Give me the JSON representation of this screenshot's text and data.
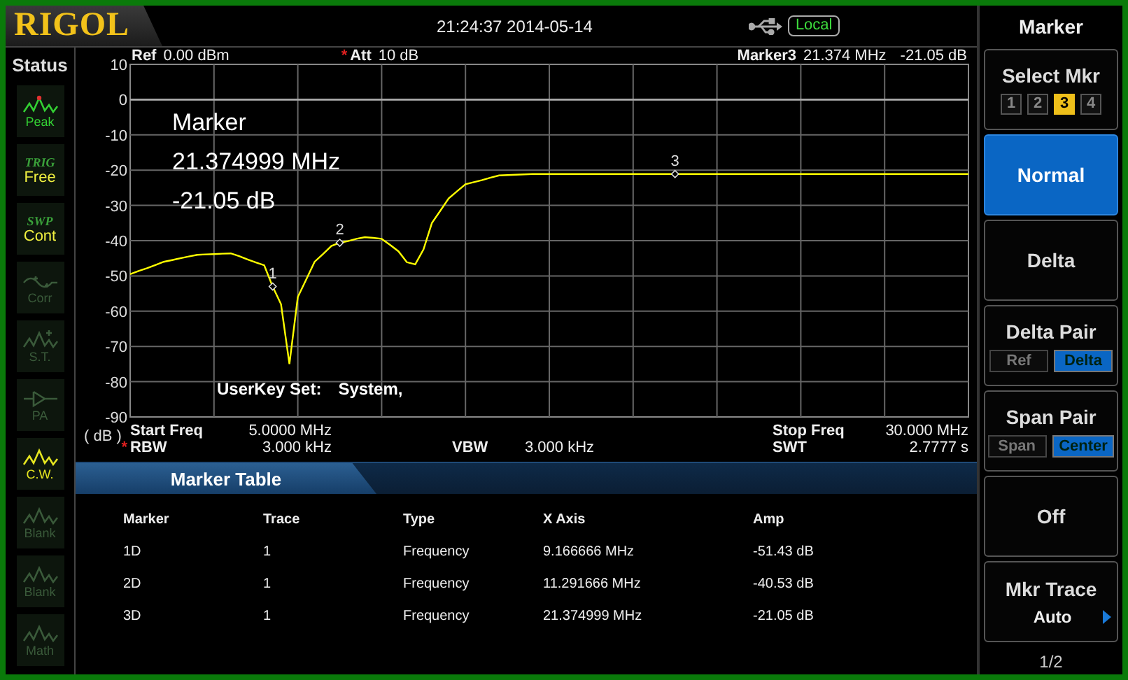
{
  "header": {
    "logo": "RIGOL",
    "datetime": "21:24:37 2014-05-14",
    "remote_status": "Local"
  },
  "status": {
    "title": "Status",
    "items": [
      {
        "kind": "peak",
        "label": "Peak",
        "color": "#33d033"
      },
      {
        "kind": "text",
        "heading": "TRIG",
        "value": "Free"
      },
      {
        "kind": "text",
        "heading": "SWP",
        "value": "Cont"
      },
      {
        "kind": "corr",
        "label": "Corr",
        "color": "#3a5a3a"
      },
      {
        "kind": "st",
        "label": "S.T.",
        "color": "#3a5a3a"
      },
      {
        "kind": "pa",
        "label": "PA",
        "color": "#3a5a3a"
      },
      {
        "kind": "wave",
        "label": "C.W.",
        "color": "#e6e620"
      },
      {
        "kind": "wave",
        "label": "Blank",
        "color": "#3a5a3a"
      },
      {
        "kind": "wave",
        "label": "Blank",
        "color": "#3a5a3a"
      },
      {
        "kind": "wave",
        "label": "Math",
        "color": "#3a5a3a"
      }
    ]
  },
  "plot": {
    "ref_label": "Ref",
    "ref_value": "0.00 dBm",
    "att_flag": "*",
    "att_label": "Att",
    "att_value": "10 dB",
    "marker_label": "Marker3",
    "marker_freq": "21.374 MHz",
    "marker_amp": "-21.05 dB",
    "readout": [
      "Marker",
      "21.374999 MHz",
      "-21.05 dB"
    ],
    "userkey_label": "UserKey Set:",
    "userkey_value": "System,",
    "trace_markers": [
      "1",
      "2",
      "3"
    ],
    "chart_data": {
      "type": "line",
      "grid": true,
      "ylabel": "( dB )",
      "ylim": [
        -90,
        10
      ],
      "yticks": [
        10,
        0,
        -10,
        -20,
        -30,
        -40,
        -50,
        -60,
        -70,
        -80,
        -90
      ],
      "categories": [
        null,
        null,
        null,
        null,
        null,
        null,
        null,
        null,
        null,
        null,
        null,
        null,
        null,
        null,
        null,
        null,
        null,
        null,
        null,
        null,
        null,
        null,
        null,
        null,
        null,
        null,
        null,
        null,
        null,
        null,
        null,
        null,
        null,
        null,
        null,
        null,
        null,
        null,
        null,
        null,
        null,
        null,
        null,
        null,
        null,
        null,
        null,
        null,
        null,
        null,
        null,
        null,
        null,
        null,
        null,
        null,
        null,
        null,
        null,
        null,
        null,
        null,
        null,
        null,
        null,
        null,
        null,
        null,
        null,
        null,
        null,
        null,
        null,
        null,
        null,
        null,
        null,
        null,
        null,
        null,
        null,
        null,
        null,
        null,
        null,
        null,
        null,
        null,
        null,
        null,
        null,
        null,
        null,
        null,
        null,
        null,
        null,
        null,
        null,
        null,
        null
      ],
      "series": [
        {
          "color": "#ffff00",
          "values": [
            -49.5,
            -48.6,
            -47.8,
            -46.9,
            -46,
            -45.5,
            -45,
            -44.5,
            -44,
            -43.9,
            -43.8,
            -43.7,
            -43.6,
            -44.4,
            -45.3,
            -46.2,
            -47,
            -53,
            -58,
            -75,
            -56,
            -51,
            -46,
            -43.8,
            -41.5,
            -40.6,
            -40.1,
            -39.5,
            -39,
            -39.2,
            -39.5,
            -41.2,
            -43,
            -46.1,
            -46.7,
            -42.5,
            -35,
            -31.5,
            -28,
            -26,
            -24,
            -23.4,
            -22.8,
            -22.1,
            -21.5,
            -21.4,
            -21.3,
            -21.2,
            -21.1,
            -21.1,
            -21.1,
            -21.1,
            -21.1,
            -21.1,
            -21.1,
            -21.1,
            -21.1,
            -21.1,
            -21.1,
            -21.1,
            -21.1,
            -21.1,
            -21.1,
            -21.1,
            -21.1,
            -21.1,
            -21.1,
            -21.1,
            -21.1,
            -21.1,
            -21.1,
            -21.1,
            -21.1,
            -21.1,
            -21.1,
            -21.1,
            -21.1,
            -21.1,
            -21.1,
            -21.1,
            -21.1,
            -21.1,
            -21.1,
            -21.1,
            -21.1,
            -21.1,
            -21.1,
            -21.1,
            -21.1,
            -21.1,
            -21.1,
            -21.1,
            -21.1,
            -21.1,
            -21.1,
            -21.1,
            -21.1,
            -21.1,
            -21.1,
            -21.1,
            -21.1
          ]
        }
      ]
    }
  },
  "settings": {
    "start_freq": {
      "label": "Start Freq",
      "value": "5.0000 MHz"
    },
    "stop_freq": {
      "label": "Stop Freq",
      "value": "30.000 MHz"
    },
    "rbw": {
      "flag": "*",
      "label": "RBW",
      "value": "3.000 kHz"
    },
    "vbw": {
      "label": "VBW",
      "value": "3.000 kHz"
    },
    "swt": {
      "label": "SWT",
      "value": "2.7777 s"
    }
  },
  "marker_table": {
    "title": "Marker Table",
    "columns": [
      "Marker",
      "Trace",
      "Type",
      "X Axis",
      "Amp"
    ],
    "rows": [
      [
        "1D",
        "1",
        "Frequency",
        "9.166666 MHz",
        "-51.43 dB"
      ],
      [
        "2D",
        "1",
        "Frequency",
        "11.291666 MHz",
        "-40.53 dB"
      ],
      [
        "3D",
        "1",
        "Frequency",
        "21.374999 MHz",
        "-21.05 dB"
      ]
    ]
  },
  "menu": {
    "title": "Marker",
    "page": "1/2",
    "keys": [
      {
        "kind": "numbers",
        "label": "Select Mkr",
        "selected": false,
        "options": [
          {
            "label": "1",
            "selected": false
          },
          {
            "label": "2",
            "selected": false
          },
          {
            "label": "3",
            "selected": true
          },
          {
            "label": "4",
            "selected": false
          }
        ]
      },
      {
        "kind": "plain",
        "label": "Normal",
        "selected": true
      },
      {
        "kind": "plain",
        "label": "Delta",
        "selected": false
      },
      {
        "kind": "pair",
        "label": "Delta Pair",
        "selected": false,
        "options": [
          {
            "label": "Ref",
            "selected": false
          },
          {
            "label": "Delta",
            "selected": true
          }
        ]
      },
      {
        "kind": "pair",
        "label": "Span Pair",
        "selected": false,
        "options": [
          {
            "label": "Span",
            "selected": false
          },
          {
            "label": "Center",
            "selected": true
          }
        ]
      },
      {
        "kind": "plain",
        "label": "Off",
        "selected": false
      },
      {
        "kind": "submenu",
        "label": "Mkr Trace",
        "value": "Auto",
        "selected": false
      }
    ]
  }
}
